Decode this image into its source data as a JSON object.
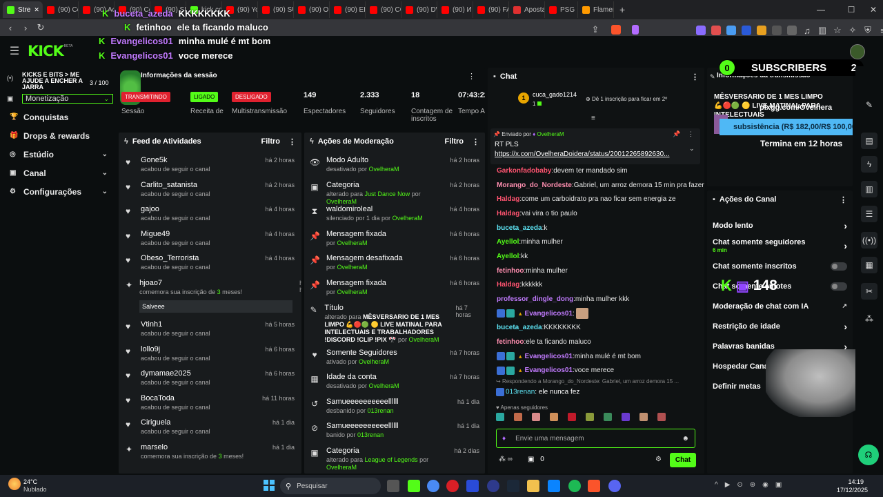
{
  "browser": {
    "tabs": [
      {
        "label": "Stre",
        "color": "#53fc18",
        "active": true
      },
      {
        "label": "(90) Con",
        "color": "#ff0000"
      },
      {
        "label": "(90) Ao",
        "color": "#ff0000"
      },
      {
        "label": "(90) Co",
        "color": "#ff0000"
      },
      {
        "label": "(90) SUP",
        "color": "#ff0000"
      },
      {
        "label": "kick.com",
        "color": "#53fc18"
      },
      {
        "label": "(90) You",
        "color": "#ff0000"
      },
      {
        "label": "(90) SUP",
        "color": "#ff0000"
      },
      {
        "label": "(90) O M",
        "color": "#ff0000"
      },
      {
        "label": "(90) EPS",
        "color": "#ff0000"
      },
      {
        "label": "(90) COR",
        "color": "#ff0000"
      },
      {
        "label": "(90) DW",
        "color": "#ff0000"
      },
      {
        "label": "(90) И С",
        "color": "#ff0000"
      },
      {
        "label": "(90) FAL",
        "color": "#ff0000"
      },
      {
        "label": "Aposta",
        "color": "#e03030"
      },
      {
        "label": "PSG",
        "color": "#ff0000"
      },
      {
        "label": "Flameng",
        "color": "#ff9a00"
      }
    ],
    "new_tab": "+"
  },
  "overlay_chat": [
    {
      "user": "Evangelicos01",
      "text": ""
    },
    {
      "user": "buceta_azeda",
      "text": "KKKKKKKK"
    },
    {
      "user": "fetinhoo",
      "text": "ele ta ficando maluco"
    },
    {
      "user": "Evangelicos01",
      "text": "minha mulé é mt bom"
    },
    {
      "user": "Evangelicos01",
      "text": "voce merece"
    }
  ],
  "header": {
    "logo": "KICK",
    "logo_sup": "BETA"
  },
  "sidebar": {
    "goal_title": "KICKS E BITS > ME AJUDE A ENCHER A JARRA",
    "goal_count": "3",
    "goal_total": "/ 100",
    "dropdown": "Monetização",
    "items": [
      {
        "label": "Conquistas",
        "icon": "trophy-icon",
        "chev": false
      },
      {
        "label": "Drops & rewards",
        "icon": "gift-icon",
        "chev": false
      },
      {
        "label": "Estúdio",
        "icon": "globe-icon",
        "chev": true
      },
      {
        "label": "Canal",
        "icon": "user-icon",
        "chev": true
      },
      {
        "label": "Configurações",
        "icon": "gear-icon",
        "chev": true
      }
    ]
  },
  "session": {
    "title": "Informações da sessão",
    "stats": [
      {
        "badge": "TRANSMITINDO",
        "label": "Sessão",
        "color": "#e0212f"
      },
      {
        "badge": "LIGADO",
        "label": "Receita de",
        "color": "#53fc18"
      },
      {
        "badge": "DESLIGADO",
        "label": "Multistransmissão",
        "color": "#e0212f"
      },
      {
        "value": "149",
        "label": "Espectadores"
      },
      {
        "value": "2.333",
        "label": "Seguidores"
      },
      {
        "value": "18",
        "label": "Contagem de inscritos"
      },
      {
        "value": "07:43:22",
        "label": "Tempo Ao Vivo"
      }
    ]
  },
  "feed": {
    "title": "Feed de Atividades",
    "filter": "Filtro",
    "items": [
      {
        "name": "Gone5k",
        "sub": "acabou de seguir o canal",
        "time": "há 2 horas",
        "icon": "heart-icon"
      },
      {
        "name": "Carlito_satanista",
        "sub": "acabou de seguir o canal",
        "time": "há 2 horas",
        "icon": "heart-icon"
      },
      {
        "name": "gajoo",
        "sub": "acabou de seguir o canal",
        "time": "há 4 horas",
        "icon": "heart-icon"
      },
      {
        "name": "Migue49",
        "sub": "acabou de seguir o canal",
        "time": "há 4 horas",
        "icon": "heart-icon"
      },
      {
        "name": "Obeso_Terrorista",
        "sub": "acabou de seguir o canal",
        "time": "há 4 horas",
        "icon": "heart-icon"
      },
      {
        "name": "hjoao7",
        "sub_pre": "comemora sua inscrição de ",
        "sub_num": "3",
        "sub_post": " meses!",
        "time": "há 4 horas",
        "icon": "star-icon",
        "message": "Salveee"
      },
      {
        "name": "Vtinh1",
        "sub": "acabou de seguir o canal",
        "time": "há 5 horas",
        "icon": "heart-icon"
      },
      {
        "name": "lollo9j",
        "sub": "acabou de seguir o canal",
        "time": "há 6 horas",
        "icon": "heart-icon"
      },
      {
        "name": "dymamae2025",
        "sub": "acabou de seguir o canal",
        "time": "há 6 horas",
        "icon": "heart-icon"
      },
      {
        "name": "BocaToda",
        "sub": "acabou de seguir o canal",
        "time": "há 11 horas",
        "icon": "heart-icon"
      },
      {
        "name": "Ciriguela",
        "sub": "acabou de seguir o canal",
        "time": "há 1 dia",
        "icon": "heart-icon"
      },
      {
        "name": "marselo",
        "sub_pre": "comemora sua inscrição de ",
        "sub_num": "3",
        "sub_post": " meses!",
        "time": "há 1 dia",
        "icon": "star-icon"
      }
    ]
  },
  "mod": {
    "title": "Ações de Moderação",
    "filter": "Filtro",
    "items": [
      {
        "name": "Modo Adulto",
        "pre": "desativado por ",
        "g": "OvelheraM",
        "post": "",
        "time": "há 2 horas",
        "icon": "👁"
      },
      {
        "name": "Categoria",
        "pre": "alterado para ",
        "g": "Just Dance Now",
        "post": " por ",
        "g2": "OvelheraM",
        "time": "há 2 horas",
        "icon": "▣"
      },
      {
        "name": "waldomiroleal",
        "pre": "silenciado por 1 dia por ",
        "g": "OvelheraM",
        "post": "",
        "time": "há 4 horas",
        "icon": "⧗"
      },
      {
        "name": "Mensagem fixada",
        "pre": "por ",
        "g": "OvelheraM",
        "post": "",
        "time": "há 6 horas",
        "icon": "📌"
      },
      {
        "name": "Mensagem desafixada",
        "pre": "por ",
        "g": "OvelheraM",
        "post": "",
        "time": "há 6 horas",
        "icon": "📌"
      },
      {
        "name": "Mensagem fixada",
        "pre": "por ",
        "g": "OvelheraM",
        "post": "",
        "time": "há 6 horas",
        "icon": "📌"
      },
      {
        "name": "Título",
        "pre": "alterado para ",
        "g": "MÊSVERSARIO DE 1 MES LIMPO 💪🔴🟢 🟡 LIVE MATINAL PARA INTELECTUAIS E TRABALHADORES !DISCORD !CLIP !PIX 🎌",
        "post": " por ",
        "g2": "OvelheraM",
        "time": "há 7 horas",
        "icon": "✎",
        "tall": true
      },
      {
        "name": "Somente Seguidores",
        "pre": "ativado por ",
        "g": "OvelheraM",
        "post": "",
        "time": "há 7 horas",
        "icon": "♥"
      },
      {
        "name": "Idade da conta",
        "pre": "desativado por ",
        "g": "OvelheraM",
        "post": "",
        "time": "há 7 horas",
        "icon": "▦"
      },
      {
        "name": "Samueeeeeeeeeellllll",
        "pre": "desbanido por ",
        "g": "013renan",
        "post": "",
        "time": "há 1 dia",
        "icon": "↺"
      },
      {
        "name": "Samueeeeeeeeeellllll",
        "pre": "banido por ",
        "g": "013renan",
        "post": "",
        "time": "há 1 dia",
        "icon": "⊘"
      },
      {
        "name": "Categoria",
        "pre": "alterado para ",
        "g": "League of Legends",
        "post": " por ",
        "g2": "OvelheraM",
        "time": "há 2 dias",
        "icon": "▣"
      }
    ]
  },
  "chat": {
    "title": "Chat",
    "top_user": "cuca_gado1214",
    "top_rank": "1",
    "top_count": "1",
    "sub_hint": "Dê 1 inscrição para ficar em 2º",
    "pinned_by": "Enviado por",
    "pinned_user": "OvelheraM",
    "pinned_title": "RT PLS",
    "pinned_link": "https://x.com/OvelheraDoidera/status/20012265892630...",
    "messages": [
      {
        "user": "Garkonfadobaby",
        "color": "#ff5470",
        "text": "devem ter mandado sim"
      },
      {
        "user": "Morango_do_Nordeste",
        "color": "#ff8fb0",
        "text": "Gabriel, um arroz demora 15 min pra fazer"
      },
      {
        "user": "Haldag",
        "color": "#ff5470",
        "text": "come um carboidrato pra nao ficar sem energia ze"
      },
      {
        "user": "Haldag",
        "color": "#ff5470",
        "text": "vai vira o tio paulo"
      },
      {
        "user": "buceta_azeda",
        "color": "#5ee5f5",
        "text": "k"
      },
      {
        "user": "Ayellol",
        "color": "#53fc18",
        "text": "minha mulher"
      },
      {
        "user": "Ayellol",
        "color": "#53fc18",
        "text": "kk"
      },
      {
        "user": "fetinhoo",
        "color": "#ff8fb0",
        "text": "minha mulher"
      },
      {
        "user": "Haldag",
        "color": "#ff5470",
        "text": "kkkkkk"
      },
      {
        "user": "professor_dingle_dong",
        "color": "#c27bff",
        "text": "minha mulher kkk"
      },
      {
        "user": "Evangelicos01",
        "color": "#c27bff",
        "text": "",
        "badges": true,
        "emote": true
      },
      {
        "user": "buceta_azeda",
        "color": "#5ee5f5",
        "text": "KKKKKKKK"
      },
      {
        "user": "fetinhoo",
        "color": "#ff8fb0",
        "text": "ele ta ficando maluco"
      },
      {
        "user": "Evangelicos01",
        "color": "#c27bff",
        "text": "minha mulé é mt bom",
        "badges": true
      },
      {
        "user": "Evangelicos01",
        "color": "#c27bff",
        "text": "voce merece",
        "badges": true
      }
    ],
    "reply_hint": "Respondendo a Morango_do_Nordeste: Gabriel, um arroz demora 15 ...",
    "reply_user": "013renan",
    "reply_text": "ele nunca fez",
    "followers_only": "Apenas seguidores",
    "input_placeholder": "Envie uma mensagem",
    "points": "0",
    "send": "Chat"
  },
  "stream_info": {
    "title": "Informações da transmissão",
    "stream_title": "MÊSVERSARIO DE 1 MES LIMPO 💪🔴🟢 🟡 LIVE MATINAL PARA INTELECTUAIS",
    "subs_label": "SUBSCRIBERS",
    "subs_left": "0",
    "subs_right": "2",
    "pix": "pixgg.com/Ovelhera",
    "goal_text": "subsistência (R$ 182,00/R$ 100,00)",
    "ends": "Termina em 12 horas"
  },
  "channel_actions": {
    "title": "Ações do Canal",
    "viewers_overlay": "148",
    "items": [
      {
        "label": "Modo lento",
        "ctrl": "chev"
      },
      {
        "label": "Chat somente seguidores",
        "sub": "6 min",
        "ctrl": "chev"
      },
      {
        "label": "Chat somente inscritos",
        "ctrl": "toggle"
      },
      {
        "label": "Chat somente emotes",
        "ctrl": "toggle"
      },
      {
        "label": "Moderação de chat com IA",
        "ctrl": "ext"
      },
      {
        "label": "Restrição de idade",
        "ctrl": "chev"
      },
      {
        "label": "Palavras banidas",
        "ctrl": "chev"
      },
      {
        "label": "Hospedar Canal",
        "ctrl": "none"
      },
      {
        "label": "Definir metas",
        "ctrl": "none"
      }
    ]
  },
  "taskbar": {
    "temp": "24°C",
    "weather": "Nublado",
    "search": "Pesquisar",
    "time": "14:19",
    "date": "17/12/2025"
  }
}
